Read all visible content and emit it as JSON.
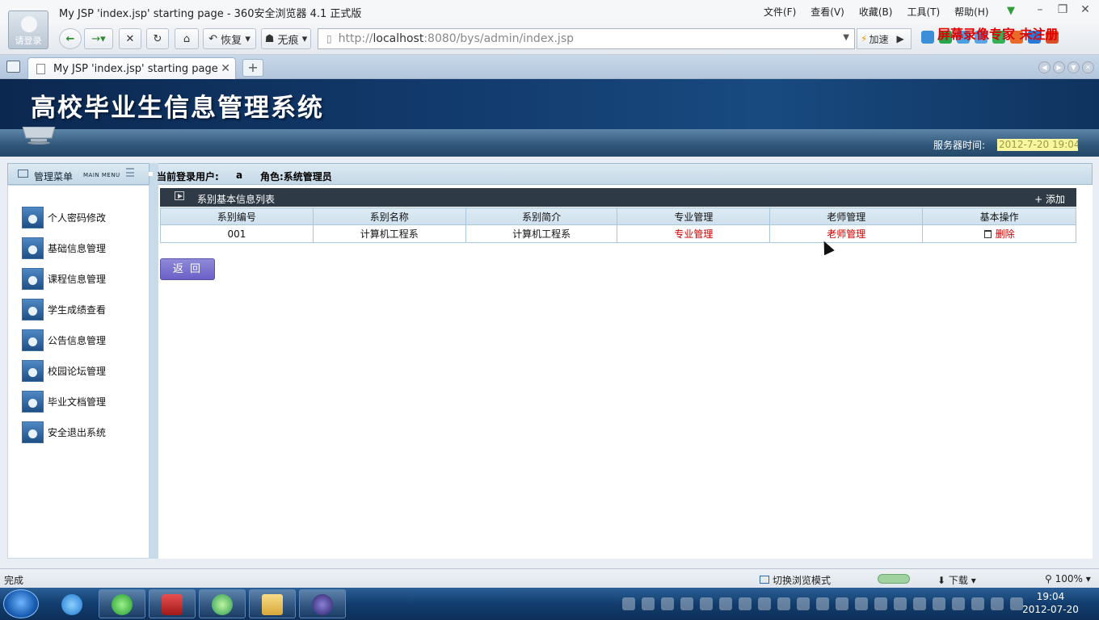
{
  "browser": {
    "window_title": "My JSP 'index.jsp' starting page - 360安全浏览器 4.1 正式版",
    "avatar_label": "请登录",
    "menus": [
      "文件(F)",
      "查看(V)",
      "收藏(B)",
      "工具(T)",
      "帮助(H)"
    ],
    "toolbar": {
      "restore_label": "恢复",
      "no_trace_label": "无痕",
      "speed_label": "加速"
    },
    "address": {
      "scheme_prefix": "http://",
      "host": "localhost",
      "rest": ":8080/bys/admin/index.jsp"
    },
    "watermark": "屏幕录像专家 未注册",
    "tab_title": "My JSP 'index.jsp' starting page",
    "status_text": "完成",
    "mode_label": "切换浏览模式",
    "download_label": "下载",
    "zoom_label": "100%"
  },
  "app": {
    "system_title": "高校毕业生信息管理系统",
    "server_time_label": "服务器时间:",
    "server_time": "2012-7-20 19:04:",
    "menu_header": {
      "cn": "管理菜单",
      "en": "MAIN MENU"
    },
    "menu_items": [
      {
        "label": "个人密码修改"
      },
      {
        "label": "基础信息管理"
      },
      {
        "label": "课程信息管理"
      },
      {
        "label": "学生成绩查看"
      },
      {
        "label": "公告信息管理"
      },
      {
        "label": "校园论坛管理"
      },
      {
        "label": "毕业文档管理"
      },
      {
        "label": "安全退出系统"
      }
    ],
    "user_bar": {
      "user_label": "当前登录用户:",
      "user_value": "a",
      "role_label": "角色:系统管理员"
    },
    "list": {
      "title": "系别基本信息列表",
      "add_label": "+ 添加",
      "columns": [
        "系别编号",
        "系别名称",
        "系别简介",
        "专业管理",
        "老师管理",
        "基本操作"
      ],
      "rows": [
        {
          "id": "001",
          "name": "计算机工程系",
          "intro": "计算机工程系",
          "major_link": "专业管理",
          "teacher_link": "老师管理",
          "delete_link": "删除"
        }
      ]
    },
    "back_button": "返 回"
  },
  "taskbar": {
    "clock_time": "19:04",
    "clock_date": "2012-07-20"
  }
}
